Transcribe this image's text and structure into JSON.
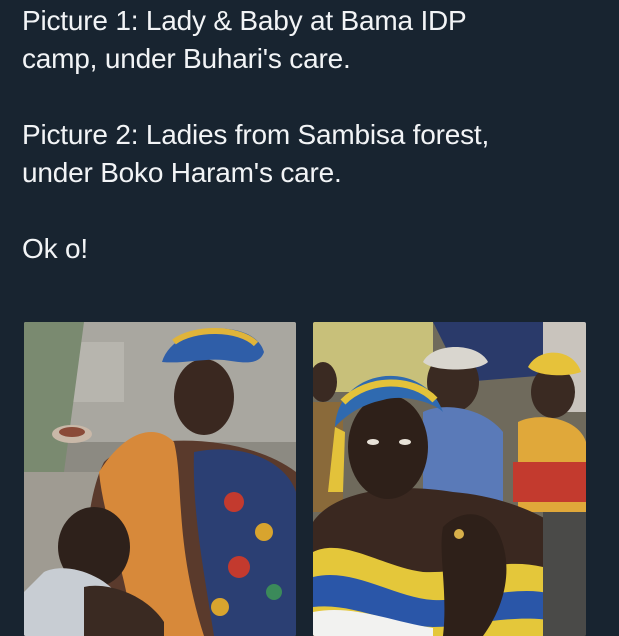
{
  "tweet": {
    "line_1": "Picture 1: Lady & Baby at Bama IDP",
    "line_2": "camp, under Buhari's care.",
    "line_3": "Picture 2: Ladies from Sambisa forest,",
    "line_4": "under Boko Haram's care.",
    "line_5": "Ok o!"
  },
  "photos": [
    {
      "icon": "photo-woman-and-baby"
    },
    {
      "icon": "photo-group-of-young-women"
    }
  ],
  "colors": {
    "background": "#182430",
    "text": "#f2f4f6"
  }
}
